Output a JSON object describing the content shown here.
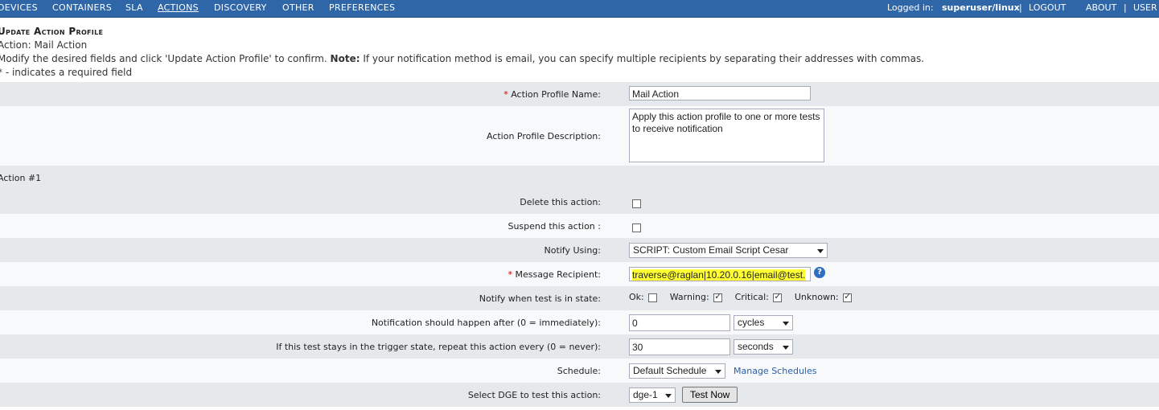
{
  "nav": {
    "items": [
      "DEVICES",
      "CONTAINERS",
      "SLA",
      "ACTIONS",
      "DISCOVERY",
      "OTHER",
      "PREFERENCES"
    ],
    "logged_in_label": "Logged in:",
    "user": "superuser/linux",
    "sep": "|",
    "logout": "LOGOUT",
    "about": "ABOUT",
    "user_link": "USER"
  },
  "header": {
    "title": "Update Action Profile",
    "action_line": "Action: Mail Action",
    "instructions_prefix": "Modify the desired fields and click 'Update Action Profile' to confirm.",
    "note_label": "Note:",
    "note_text": "If your notification method is email, you can specify multiple recipients by separating their addresses with commas.",
    "required_note": "* - indicates a required field",
    "required_star": "*"
  },
  "form": {
    "profile_name_label": "Action Profile Name:",
    "profile_name_value": "Mail Action",
    "profile_desc_label": "Action Profile Description:",
    "profile_desc_value": "Apply this action profile to one or more tests to receive notification",
    "action_section": "Action #1",
    "delete_label": "Delete this action:",
    "suspend_label": "Suspend this action :",
    "notify_using_label": "Notify Using:",
    "notify_using_value": "SCRIPT: Custom Email Script Cesar",
    "recipient_label": "Message Recipient:",
    "recipient_value": "traverse@raglan|10.20.0.16|email@test.",
    "recipient_help": "?",
    "state_label": "Notify when test is in state:",
    "states": [
      {
        "label": "Ok:",
        "checked": false
      },
      {
        "label": "Warning:",
        "checked": true
      },
      {
        "label": "Critical:",
        "checked": true
      },
      {
        "label": "Unknown:",
        "checked": true
      }
    ],
    "after_label": "Notification should happen after (0 = immediately):",
    "after_value": "0",
    "after_unit": "cycles",
    "repeat_label": "If this test stays in the trigger state, repeat this action every (0 = never):",
    "repeat_value": "30",
    "repeat_unit": "seconds",
    "schedule_label": "Schedule:",
    "schedule_value": "Default Schedule",
    "manage_schedules": "Manage Schedules",
    "dge_label": "Select DGE to test this action:",
    "dge_value": "dge-1",
    "test_now": "Test Now"
  }
}
